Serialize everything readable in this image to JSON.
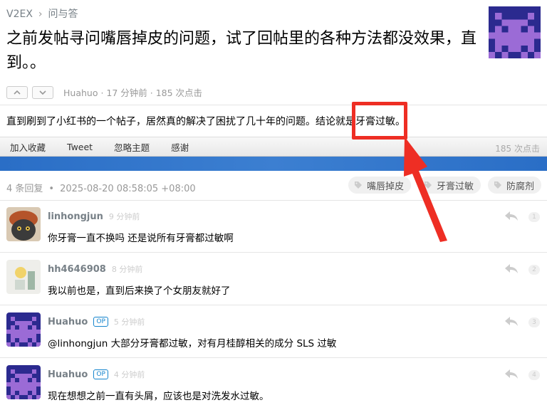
{
  "breadcrumb": {
    "site": "V2EX",
    "sep": "›",
    "node": "问与答"
  },
  "topic": {
    "title": "之前发帖寻问嘴唇掉皮的问题，试了回帖里的各种方法都没效果，直到。。",
    "author": "Huahuo",
    "meta": "Huahuo · 17 分钟前 · 185 次点击",
    "content": "直到刷到了小红书的一个帖子，居然真的解决了困扰了几十年的问题。结论就是牙膏过敏。"
  },
  "toolbar": {
    "favorite": "加入收藏",
    "tweet": "Tweet",
    "ignore": "忽略主题",
    "thanks": "感谢",
    "hits": "185 次点击"
  },
  "replies_header": {
    "count": "4 条回复",
    "dot": "•",
    "datetime": "2025-08-20 08:58:05 +08:00",
    "tags": [
      "嘴唇掉皮",
      "牙膏过敏",
      "防腐剂"
    ]
  },
  "replies": [
    {
      "user": "linhongjun",
      "op": "",
      "time": "9 分钟前",
      "text": "你牙膏一直不换吗 还是说所有牙膏都过敏啊",
      "floor": "1"
    },
    {
      "user": "hh4646908",
      "op": "",
      "time": "8 分钟前",
      "text": "我以前也是，直到后来换了个女朋友就好了",
      "floor": "2"
    },
    {
      "user": "Huahuo",
      "op": "OP",
      "time": "5 分钟前",
      "text": "@linhongjun 大部分牙膏都过敏，对有月桂醇相关的成分 SLS 过敏",
      "floor": "3"
    },
    {
      "user": "Huahuo",
      "op": "OP",
      "time": "4 分钟前",
      "text": "现在想想之前一直有头屑，应该也是对洗发水过敏。",
      "floor": "4"
    }
  ],
  "colors": {
    "accent_blue": "#2a6ec6",
    "annotation_red": "#ee2e24",
    "avatar_purple": "#9b6bd6",
    "avatar_navy": "#2b2a8f"
  },
  "icons": {
    "upvote": "chevron-up-icon",
    "downvote": "chevron-down-icon",
    "tag": "tag-icon",
    "reply": "reply-arrow-icon"
  }
}
